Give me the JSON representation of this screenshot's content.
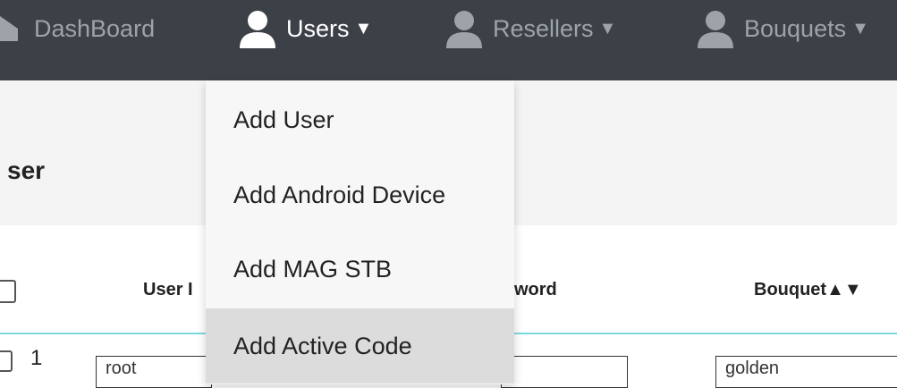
{
  "navbar": {
    "items": [
      {
        "label": "DashBoard",
        "icon": "home-icon"
      },
      {
        "label": "Users",
        "icon": "user-icon",
        "active": true
      },
      {
        "label": "Resellers",
        "icon": "user-icon"
      },
      {
        "label": "Bouquets",
        "icon": "user-icon"
      }
    ],
    "background": "#3c4148"
  },
  "page": {
    "title": "ser"
  },
  "table": {
    "headers": {
      "user": "User I",
      "password": "word",
      "bouquet": "Bouquet▲▼"
    },
    "rows": [
      {
        "num": "1",
        "user": "root",
        "password": "",
        "bouquet": "golden"
      }
    ],
    "accent_rule": "#7dd8e0"
  },
  "users_menu": {
    "items": [
      {
        "label": "Add User"
      },
      {
        "label": "Add Android Device"
      },
      {
        "label": "Add MAG STB"
      },
      {
        "label": "Add Active Code",
        "hovered": true
      }
    ]
  }
}
